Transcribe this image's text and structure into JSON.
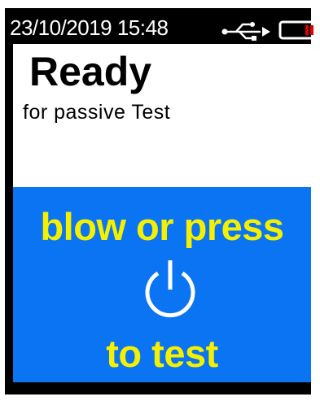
{
  "status_bar": {
    "datetime": "23/10/2019  15:48",
    "icons": [
      "usb-icon",
      "battery-low-icon"
    ]
  },
  "header": {
    "title": "Ready",
    "subtitle": "for passive Test"
  },
  "prompt": {
    "line1": "blow or press",
    "icon": "power-icon",
    "line2": "to test"
  },
  "colors": {
    "screen_background": "#000000",
    "panel_background": "#ffffff",
    "prompt_background": "#0a74f2",
    "prompt_text": "#f5f000",
    "battery_level": "#e00000"
  }
}
